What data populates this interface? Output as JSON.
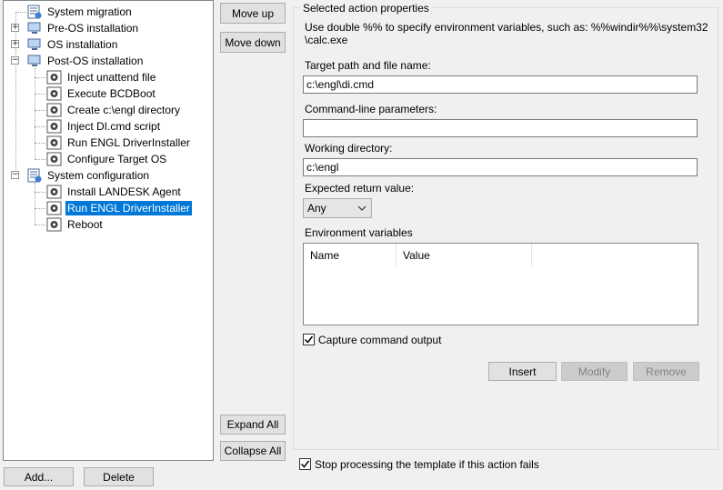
{
  "tree": {
    "items": [
      {
        "label": "System migration"
      },
      {
        "label": "Pre-OS installation"
      },
      {
        "label": "OS installation"
      },
      {
        "label": "Post-OS installation"
      },
      {
        "label": "Inject unattend file"
      },
      {
        "label": "Execute BCDBoot"
      },
      {
        "label": "Create c:\\engl directory"
      },
      {
        "label": "Inject DI.cmd script"
      },
      {
        "label": "Run ENGL DriverInstaller"
      },
      {
        "label": "Configure Target OS"
      },
      {
        "label": "System configuration"
      },
      {
        "label": "Install LANDESK Agent"
      },
      {
        "label": "Run ENGL DriverInstaller"
      },
      {
        "label": "Reboot"
      }
    ],
    "expander_collapsed": "+",
    "expander_expanded": "−"
  },
  "buttons": {
    "move_up": "Move up",
    "move_down": "Move down",
    "expand_all": "Expand All",
    "collapse_all": "Collapse All",
    "add": "Add...",
    "delete": "Delete",
    "insert": "Insert",
    "modify": "Modify",
    "remove": "Remove"
  },
  "properties": {
    "group_title": "Selected action properties",
    "hint_line1": "Use double %% to specify environment variables, such as: %%windir%%\\system32",
    "hint_line2": "\\calc.exe",
    "target_label": "Target path and file name:",
    "target_value": "c:\\engl\\di.cmd",
    "params_label": "Command-line parameters:",
    "params_value": "",
    "workdir_label": "Working directory:",
    "workdir_value": "c:\\engl",
    "return_label": "Expected return value:",
    "return_value": "Any",
    "env_label": "Environment variables",
    "env_columns": [
      "Name",
      "Value"
    ],
    "capture_label": "Capture command output",
    "capture_checked": true,
    "stop_label": "Stop processing the template if this action fails",
    "stop_checked": true
  }
}
